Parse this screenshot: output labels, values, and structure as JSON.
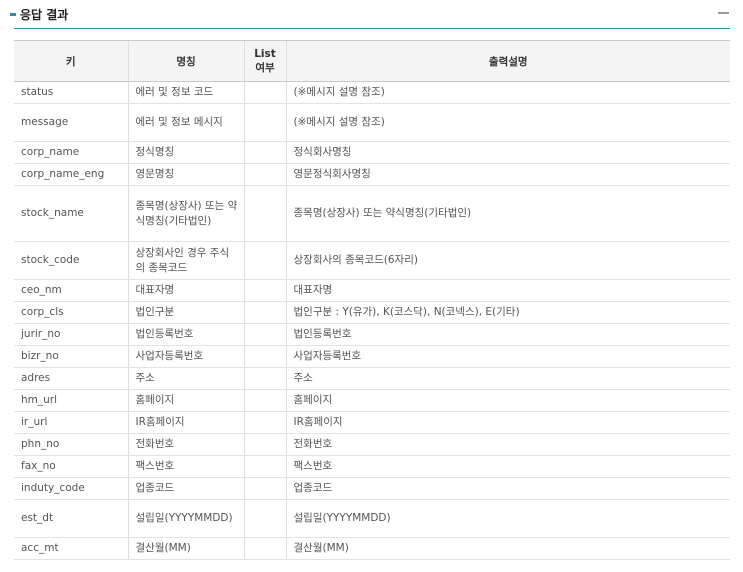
{
  "section": {
    "title": "응답 결과"
  },
  "table": {
    "headers": [
      "키",
      "명칭",
      "List\n여부",
      "출력설명"
    ],
    "rows": [
      {
        "key": "status",
        "name": "에러 및 정보 코드",
        "list": "",
        "desc": "(※메시지 설명 참조)",
        "lines": 1
      },
      {
        "key": "message",
        "name": "에러 및 정보 메시지",
        "list": "",
        "desc": "(※메시지 설명 참조)",
        "lines": 2
      },
      {
        "key": "corp_name",
        "name": "정식명칭",
        "list": "",
        "desc": "정식회사명칭",
        "lines": 1
      },
      {
        "key": "corp_name_eng",
        "name": "영문명칭",
        "list": "",
        "desc": "영문정식회사명칭",
        "lines": 1
      },
      {
        "key": "stock_name",
        "name": "종목명(상장사) 또는 약식명칭(기타법인)",
        "list": "",
        "desc": "종목명(상장사) 또는 약식명칭(기타법인)",
        "lines": 3
      },
      {
        "key": "stock_code",
        "name": "상장회사인 경우 주식의 종목코드",
        "list": "",
        "desc": "상장회사의 종목코드(6자리)",
        "lines": 2
      },
      {
        "key": "ceo_nm",
        "name": "대표자명",
        "list": "",
        "desc": "대표자명",
        "lines": 1
      },
      {
        "key": "corp_cls",
        "name": "법인구분",
        "list": "",
        "desc": "법인구분 : Y(유가), K(코스닥), N(코넥스), E(기타)",
        "lines": 1
      },
      {
        "key": "jurir_no",
        "name": "법인등록번호",
        "list": "",
        "desc": "법인등록번호",
        "lines": 1
      },
      {
        "key": "bizr_no",
        "name": "사업자등록번호",
        "list": "",
        "desc": "사업자등록번호",
        "lines": 1
      },
      {
        "key": "adres",
        "name": "주소",
        "list": "",
        "desc": "주소",
        "lines": 1
      },
      {
        "key": "hm_url",
        "name": "홈페이지",
        "list": "",
        "desc": "홈페이지",
        "lines": 1
      },
      {
        "key": "ir_url",
        "name": "IR홈페이지",
        "list": "",
        "desc": "IR홈페이지",
        "lines": 1
      },
      {
        "key": "phn_no",
        "name": "전화번호",
        "list": "",
        "desc": "전화번호",
        "lines": 1
      },
      {
        "key": "fax_no",
        "name": "팩스번호",
        "list": "",
        "desc": "팩스번호",
        "lines": 1
      },
      {
        "key": "induty_code",
        "name": "업종코드",
        "list": "",
        "desc": "업종코드",
        "lines": 1
      },
      {
        "key": "est_dt",
        "name": "설립일(YYYYMMDD)",
        "list": "",
        "desc": "설립일(YYYYMMDD)",
        "lines": 2
      },
      {
        "key": "acc_mt",
        "name": "결산월(MM)",
        "list": "",
        "desc": "결산월(MM)",
        "lines": 1
      }
    ]
  }
}
